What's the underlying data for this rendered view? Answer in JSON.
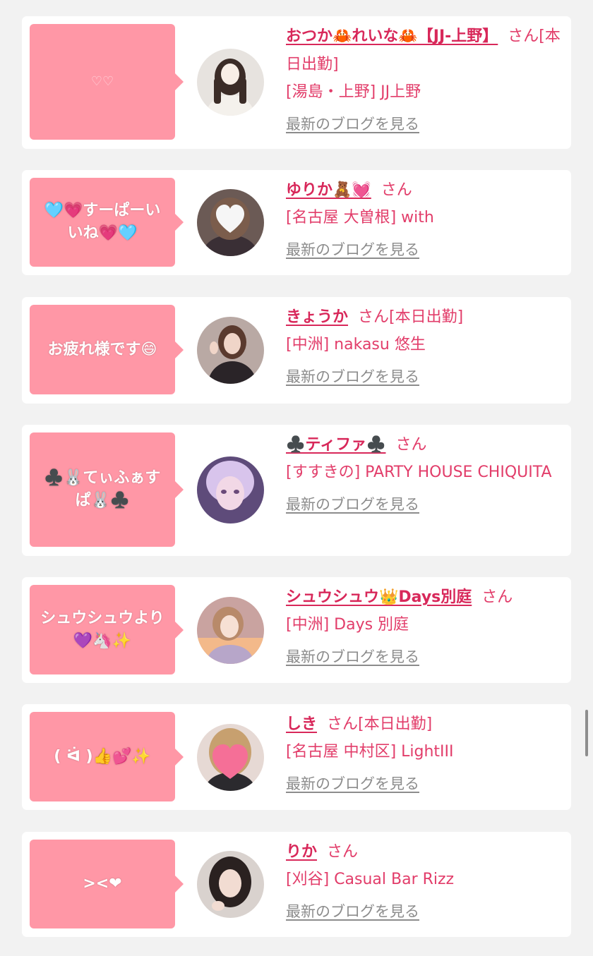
{
  "cards": [
    {
      "message": "♡♡",
      "name": "おつか🦀れいな🦀【JJ-上野】",
      "suffix": "さん[本日出勤]",
      "place": "[湯島・上野] JJ上野",
      "blog_link": "最新のブログを見る"
    },
    {
      "message": "🩵💗すーぱーいいね💗🩵",
      "name": "ゆりか🧸💓",
      "suffix": "さん",
      "place": "[名古屋 大曽根] with",
      "blog_link": "最新のブログを見る"
    },
    {
      "message": "お疲れ様です😄",
      "name": "きょうか",
      "suffix": "さん[本日出勤]",
      "place": "[中洲] nakasu 悠生",
      "blog_link": "最新のブログを見る"
    },
    {
      "message": "♣️🐰てぃふぁすぱ🐰♣️",
      "name": "♣️ティファ♣️",
      "suffix": "さん",
      "place": "[すすきの] PARTY HOUSE CHIQUITA",
      "blog_link": "最新のブログを見る"
    },
    {
      "message": "シュウシュウより💜🦄✨",
      "name": "シュウシュウ👑Days別庭",
      "suffix": "さん",
      "place": "[中洲] Days 別庭",
      "blog_link": "最新のブログを見る"
    },
    {
      "message": "( ᐛ )👍💕✨",
      "name": "しき",
      "suffix": "さん[本日出勤]",
      "place": "[名古屋 中村区] LightIII",
      "blog_link": "最新のブログを見る"
    },
    {
      "message": "><❤",
      "name": "りか",
      "suffix": "さん",
      "place": "[刈谷] Casual Bar Rizz",
      "blog_link": "最新のブログを見る"
    }
  ],
  "colors": {
    "accent": "#d8285a",
    "bubble": "#ff97a6",
    "background": "#f2f2f2"
  }
}
